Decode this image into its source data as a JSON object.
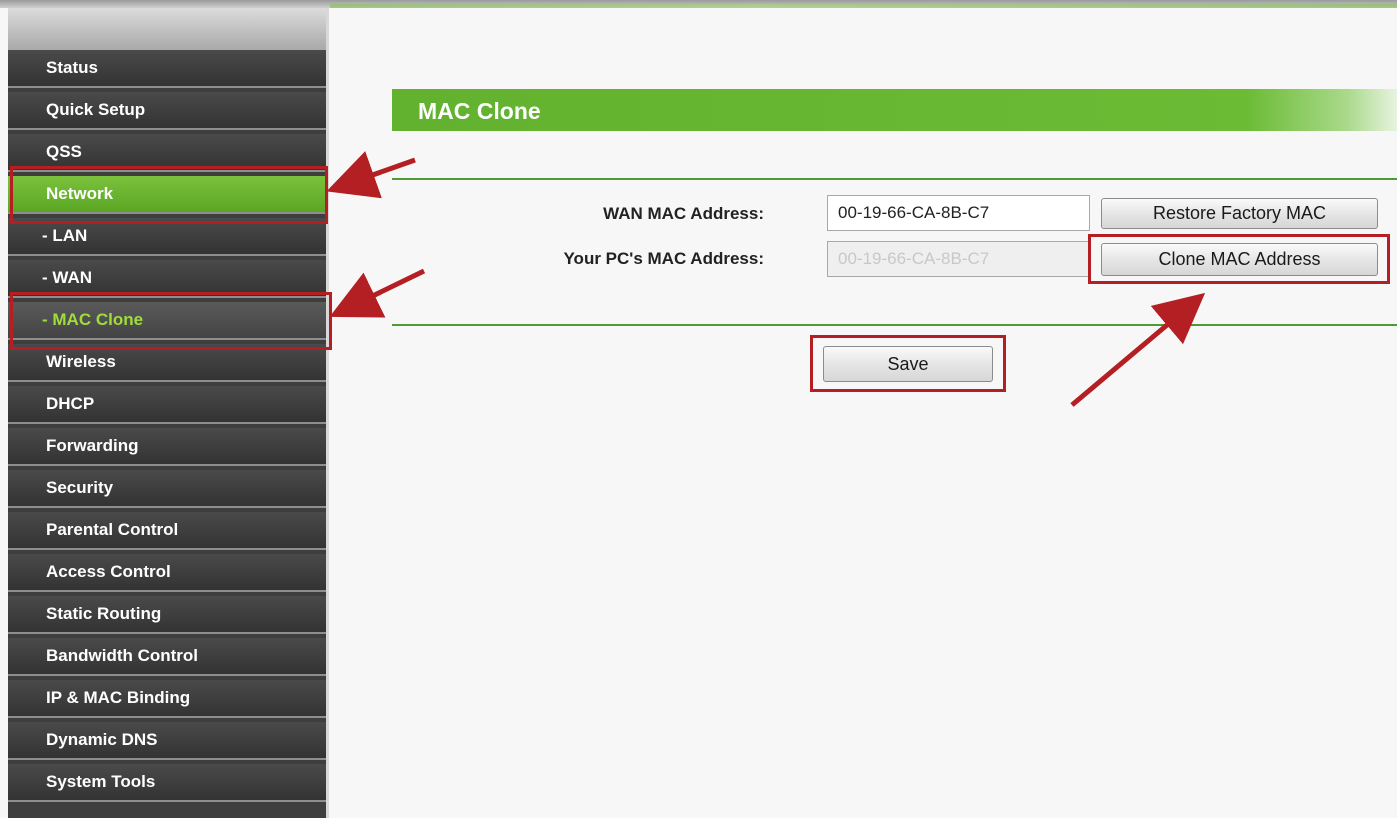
{
  "sidebar": {
    "items": [
      {
        "label": "Status"
      },
      {
        "label": "Quick Setup"
      },
      {
        "label": "QSS"
      },
      {
        "label": "Network"
      },
      {
        "label": "- LAN"
      },
      {
        "label": "- WAN"
      },
      {
        "label": "- MAC Clone"
      },
      {
        "label": "Wireless"
      },
      {
        "label": "DHCP"
      },
      {
        "label": "Forwarding"
      },
      {
        "label": "Security"
      },
      {
        "label": "Parental Control"
      },
      {
        "label": "Access Control"
      },
      {
        "label": "Static Routing"
      },
      {
        "label": "Bandwidth Control"
      },
      {
        "label": "IP & MAC Binding"
      },
      {
        "label": "Dynamic DNS"
      },
      {
        "label": "System Tools"
      }
    ]
  },
  "main": {
    "title": "MAC Clone",
    "wan_mac_label": "WAN MAC Address:",
    "wan_mac_value": "00-19-66-CA-8B-C7",
    "pc_mac_label": "Your PC's MAC Address:",
    "pc_mac_value": "00-19-66-CA-8B-C7",
    "restore_button": "Restore Factory MAC",
    "clone_button": "Clone MAC Address",
    "save_button": "Save"
  },
  "colors": {
    "accent_green": "#62b22f",
    "annotation_red": "#b41f24",
    "sidebar_dark": "#3e3e3e"
  }
}
